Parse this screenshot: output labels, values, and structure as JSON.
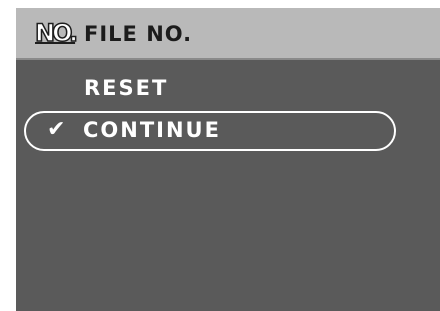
{
  "header": {
    "icon_text": "NO.",
    "title": "FILE NO."
  },
  "menu": {
    "items": [
      {
        "label": "RESET",
        "selected": false
      },
      {
        "label": "CONTINUE",
        "selected": true
      }
    ],
    "check_glyph": "✔"
  },
  "colors": {
    "background": "#5a5a5a",
    "header_background": "#b9b9b9",
    "text": "#ffffff",
    "header_text": "#1c1c1c",
    "selection_border": "#ffffff"
  },
  "icons": {
    "header": "file-number-icon",
    "selected": "check-icon"
  }
}
